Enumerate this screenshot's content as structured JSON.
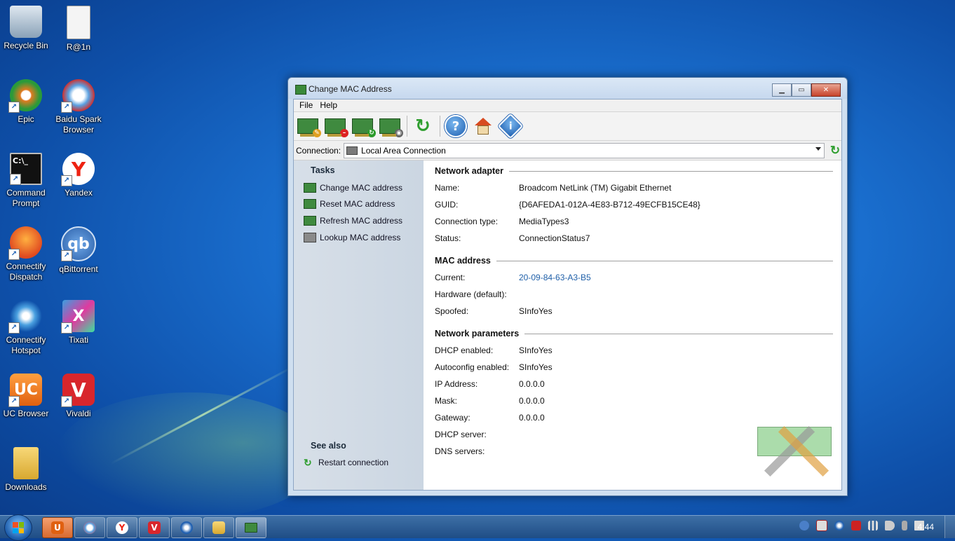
{
  "desktop": {
    "icons": [
      {
        "label": "Recycle Bin"
      },
      {
        "label": "R@1n"
      },
      {
        "label": "Epic"
      },
      {
        "label": "Baidu Spark Browser"
      },
      {
        "label": "Command Prompt"
      },
      {
        "label": "Yandex"
      },
      {
        "label": "Connectify Dispatch"
      },
      {
        "label": "qBittorrent"
      },
      {
        "label": "Connectify Hotspot"
      },
      {
        "label": "Tixati"
      },
      {
        "label": "UC Browser"
      },
      {
        "label": "Vivaldi"
      },
      {
        "label": "Downloads"
      }
    ]
  },
  "window": {
    "title": "Change MAC Address",
    "menu": [
      "File",
      "Help"
    ],
    "toolbar": {
      "icons": [
        "change-mac-icon",
        "reset-mac-icon",
        "refresh-mac-icon",
        "lookup-mac-icon",
        "restart-connection-icon",
        "help-icon",
        "home-icon",
        "info-icon"
      ]
    },
    "connection": {
      "label": "Connection:",
      "value": "Local Area Connection"
    },
    "tasks": {
      "title": "Tasks",
      "items": [
        "Change MAC address",
        "Reset MAC address",
        "Refresh MAC address",
        "Lookup MAC address"
      ],
      "see_also_title": "See also",
      "see_also_items": [
        "Restart connection"
      ]
    },
    "details": {
      "adapter_title": "Network adapter",
      "adapter": [
        {
          "k": "Name:",
          "v": "Broadcom NetLink (TM) Gigabit Ethernet"
        },
        {
          "k": "GUID:",
          "v": "{D6AFEDA1-012A-4E83-B712-49ECFB15CE48}"
        },
        {
          "k": "Connection type:",
          "v": "MediaTypes3"
        },
        {
          "k": "Status:",
          "v": "ConnectionStatus7"
        }
      ],
      "mac_title": "MAC address",
      "mac": [
        {
          "k": "Current:",
          "v": "20-09-84-63-A3-B5"
        },
        {
          "k": "Hardware (default):",
          "v": ""
        },
        {
          "k": "Spoofed:",
          "v": "SInfoYes"
        }
      ],
      "params_title": "Network parameters",
      "params": [
        {
          "k": "DHCP enabled:",
          "v": "SInfoYes"
        },
        {
          "k": "Autoconfig enabled:",
          "v": "SInfoYes"
        },
        {
          "k": "IP Address:",
          "v": "0.0.0.0"
        },
        {
          "k": "Mask:",
          "v": "0.0.0.0"
        },
        {
          "k": "Gateway:",
          "v": "0.0.0.0"
        },
        {
          "k": "DHCP server:",
          "v": ""
        },
        {
          "k": "DNS servers:",
          "v": ""
        }
      ]
    }
  },
  "taskbar": {
    "clock": "4:44"
  },
  "colors": {
    "link": "#1f5fa8",
    "desktop": "#1a6fcf"
  }
}
